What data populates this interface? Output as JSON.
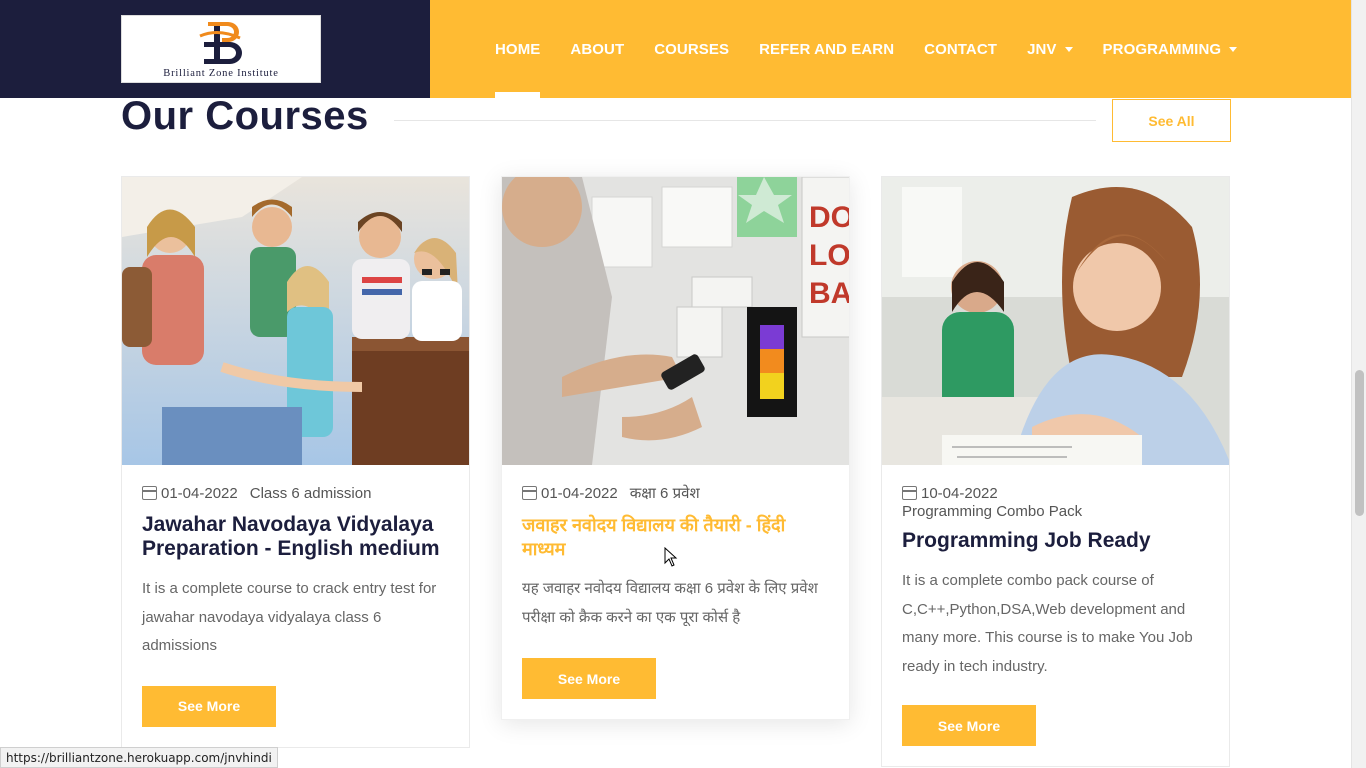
{
  "logo": {
    "text": "Brilliant Zone Institute"
  },
  "nav": [
    {
      "label": "HOME",
      "active": true,
      "dropdown": false
    },
    {
      "label": "ABOUT",
      "active": false,
      "dropdown": false
    },
    {
      "label": "COURSES",
      "active": false,
      "dropdown": false
    },
    {
      "label": "REFER AND EARN",
      "active": false,
      "dropdown": false
    },
    {
      "label": "CONTACT",
      "active": false,
      "dropdown": false
    },
    {
      "label": "JNV",
      "active": false,
      "dropdown": true
    },
    {
      "label": "PROGRAMMING",
      "active": false,
      "dropdown": true
    }
  ],
  "section": {
    "title": "Our Courses",
    "see_all_label": "See All"
  },
  "courses": [
    {
      "date": "01-04-2022",
      "category": "Class 6 admission",
      "title": "Jawahar Navodaya Vidyalaya Preparation - English medium",
      "description": "It is a complete course to crack entry test for jawahar navodaya vidyalaya class 6 admissions",
      "button": "See More"
    },
    {
      "date": "01-04-2022",
      "category": "कक्षा 6 प्रवेश",
      "title": "जवाहर नवोदय विद्यालय की तैयारी - हिंदी माध्यम",
      "description": "यह जवाहर नवोदय विद्यालय कक्षा 6 प्रवेश के लिए प्रवेश परीक्षा को क्रैक करने का एक पूरा कोर्स है",
      "button": "See More"
    },
    {
      "date": "10-04-2022",
      "category": "Programming Combo Pack",
      "title": "Programming Job Ready",
      "description": "It is a complete combo pack course of C,C++,Python,DSA,Web development and many more. This course is to make You Job ready in tech industry.",
      "button": "See More"
    }
  ],
  "status_url": "https://brilliantzone.herokuapp.com/jnvhindi",
  "colors": {
    "navy": "#1c1e3d",
    "accent": "#ffbb33"
  }
}
